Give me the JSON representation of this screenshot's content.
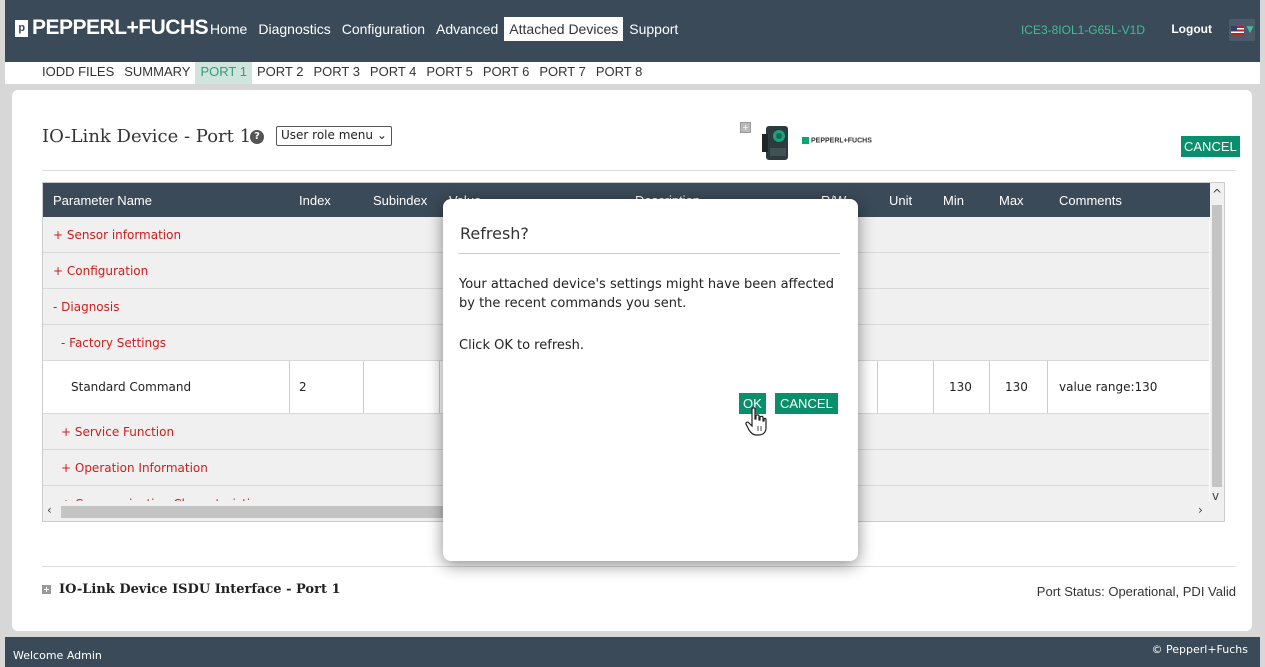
{
  "header": {
    "brand": "PEPPERL+FUCHS",
    "nav": [
      "Home",
      "Diagnostics",
      "Configuration",
      "Advanced",
      "Attached Devices",
      "Support"
    ],
    "active_nav": "Attached Devices",
    "device_id": "ICE3-8IOL1-G65L-V1D",
    "logout": "Logout",
    "language_icon": "us-flag-icon"
  },
  "subnav": {
    "items": [
      "IODD FILES",
      "SUMMARY",
      "PORT 1",
      "PORT 2",
      "PORT 3",
      "PORT 4",
      "PORT 5",
      "PORT 6",
      "PORT 7",
      "PORT 8"
    ],
    "active": "PORT 1"
  },
  "page": {
    "title": "IO-Link Device - Port 1",
    "role_menu": "User role menu",
    "cancel": "CANCEL",
    "mini_brand": "PEPPERL+FUCHS"
  },
  "table": {
    "headers": [
      "Parameter Name",
      "Index",
      "Subindex",
      "Value",
      "Description",
      "R/W",
      "Unit",
      "Min",
      "Max",
      "Comments"
    ],
    "rows": [
      {
        "name": "+ Sensor information"
      },
      {
        "name": "+ Configuration"
      },
      {
        "name": "- Diagnosis"
      },
      {
        "name": "- Factory Settings"
      },
      {
        "name": "Standard Command",
        "index": "2",
        "min": "130",
        "max": "130",
        "comments": "value range:130"
      },
      {
        "name": "+ Service Function"
      },
      {
        "name": "+ Operation Information"
      },
      {
        "name": "+ Communication Characteristics"
      }
    ]
  },
  "isdu": {
    "title": "IO-Link Device ISDU Interface - Port 1"
  },
  "port_status": "Port Status: Operational, PDI Valid",
  "footer": {
    "left": "Welcome Admin",
    "right": "© Pepperl+Fuchs"
  },
  "dialog": {
    "title": "Refresh?",
    "message": "Your attached device's settings might have been affected by the recent commands you sent.",
    "instruction": "Click OK to refresh.",
    "ok": "OK",
    "cancel": "CANCEL"
  },
  "colors": {
    "nav_bg": "#3b4a58",
    "accent": "#0a8f6c",
    "group_text": "#d01c1c"
  }
}
